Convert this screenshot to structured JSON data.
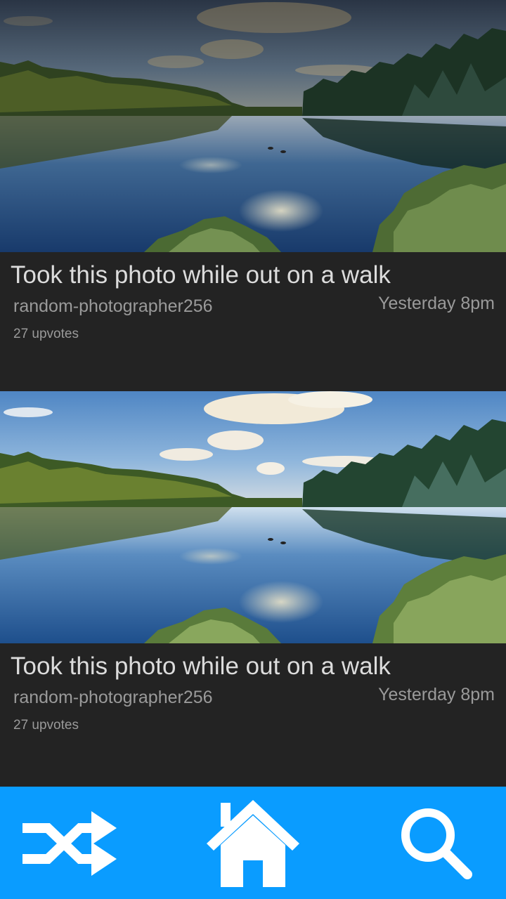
{
  "posts": [
    {
      "title": "Took this photo while out on a walk",
      "author": "random-photographer256",
      "time": "Yesterday 8pm",
      "upvotes": "27 upvotes",
      "photo": "lake-forest-photo"
    },
    {
      "title": "Took this photo while out on a walk",
      "author": "random-photographer256",
      "time": "Yesterday 8pm",
      "upvotes": "27 upvotes",
      "photo": "lake-forest-photo"
    }
  ],
  "nav": {
    "items": [
      {
        "icon": "shuffle-icon"
      },
      {
        "icon": "home-icon"
      },
      {
        "icon": "search-icon"
      }
    ]
  },
  "colors": {
    "accent": "#0a9cff",
    "card": "#232323",
    "title_text": "#dcdcdc",
    "meta_text": "#9a9a9a"
  }
}
